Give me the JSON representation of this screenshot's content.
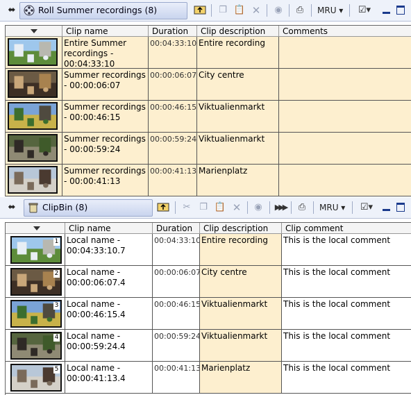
{
  "roll": {
    "title": "Roll  Summer recordings (8)",
    "mru_label": "MRU",
    "columns": [
      "",
      "Clip name",
      "Duration",
      "Clip description",
      "Comments"
    ],
    "rows": [
      {
        "name": "Entire Summer recordings - 00:04:33:10",
        "duration": "00:04:33:10",
        "description": "Entire recording",
        "comment": ""
      },
      {
        "name": "Summer recordings - 00:00:06:07",
        "duration": "00:00:06:07",
        "description": "City centre",
        "comment": ""
      },
      {
        "name": "Summer recordings - 00:00:46:15",
        "duration": "00:00:46:15",
        "description": "Viktualienmarkt",
        "comment": ""
      },
      {
        "name": "Summer recordings - 00:00:59:24",
        "duration": "00:00:59:24",
        "description": "Viktualienmarkt",
        "comment": ""
      },
      {
        "name": "Summer recordings - 00:00:41:13",
        "duration": "00:00:41:13",
        "description": "Marienplatz",
        "comment": ""
      }
    ]
  },
  "clipbin": {
    "title": "ClipBin (8)",
    "mru_label": "MRU",
    "columns": [
      "",
      "Clip name",
      "Duration",
      "Clip description",
      "Clip comment"
    ],
    "rows": [
      {
        "badge": "1",
        "name": "Local name - 00:04:33:10.7",
        "duration": "00:04:33:10",
        "description": "Entire recording",
        "comment": "This is the local comment"
      },
      {
        "badge": "2",
        "name": "Local name - 00:00:06:07.4",
        "duration": "00:00:06:07",
        "description": "City centre",
        "comment": "This is the local comment"
      },
      {
        "badge": "3",
        "name": "Local name - 00:00:46:15.4",
        "duration": "00:00:46:15",
        "description": "Viktualienmarkt",
        "comment": "This is the local comment"
      },
      {
        "badge": "4",
        "name": "Local name - 00:00:59:24.4",
        "duration": "00:00:59:24",
        "description": "Viktualienmarkt",
        "comment": "This is the local comment"
      },
      {
        "badge": "5",
        "name": "Local name - 00:00:41:13.4",
        "duration": "00:00:41:13",
        "description": "Marienplatz",
        "comment": "This is the local comment"
      }
    ]
  },
  "icons": {
    "pin": "pin-icon",
    "roll": "film-reel-icon",
    "clipbin": "bin-icon",
    "up": "up-folder-icon",
    "cut": "scissors-icon",
    "copy": "copy-icon",
    "paste": "paste-icon",
    "delete": "delete-x-icon",
    "eye": "preview-eye-icon",
    "play": "play-forward-icon",
    "print": "printer-icon",
    "props": "properties-icon",
    "minimize": "minimize-icon",
    "maximize": "maximize-icon"
  },
  "colors": {
    "tan": "#fdefcf",
    "toolbar": "#eef2fa",
    "title_grad": "#c9d4ee"
  }
}
